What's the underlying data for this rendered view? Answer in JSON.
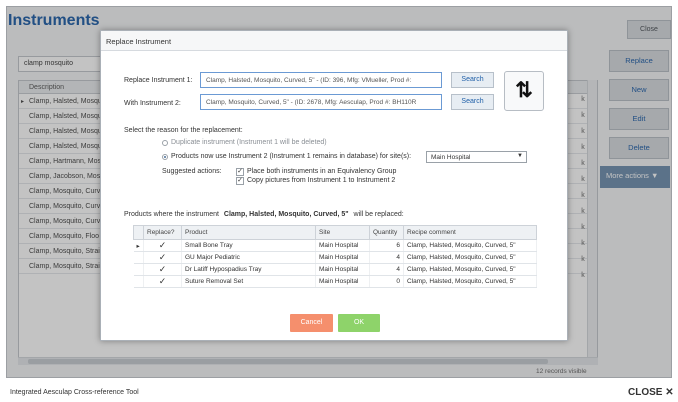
{
  "main": {
    "title": "Instruments",
    "close_label": "Close",
    "search_value": "clamp mosquito",
    "column_header": "Description",
    "rows": [
      "Clamp, Halsted, Mosqu",
      "Clamp, Halsted, Mosqu",
      "Clamp, Halsted, Mosqu",
      "Clamp, Halsted, Mosqu",
      "Clamp, Hartmann, Mos",
      "Clamp, Jacobson, Mosc",
      "Clamp, Mosquito, Curv",
      "Clamp, Mosquito, Curv",
      "Clamp, Mosquito, Curv",
      "Clamp, Mosquito, Floo",
      "Clamp, Mosquito, Strai",
      "Clamp, Mosquito, Strai"
    ],
    "right_column_char": "k",
    "records_text": "12 records visible",
    "side_buttons": [
      "Replace",
      "New",
      "Edit",
      "Delete"
    ],
    "more_actions": "More actions ▼",
    "footer_text": "Integrated Aesculap Cross-reference Tool",
    "footer_close": "CLOSE ✕"
  },
  "dialog": {
    "title": "Replace Instrument",
    "replace_label": "Replace Instrument 1:",
    "replace_value": "Clamp, Halsted, Mosquito, Curved, 5\" - (ID: 396, Mfg: VMueller, Prod #:",
    "with_label": "With Instrument 2:",
    "with_value": "Clamp, Mosquito, Curved, 5\" - (ID: 2678, Mfg: Aesculap, Prod #: BH110R",
    "search_label": "Search",
    "swap_icon_glyph": "⇅",
    "reason_label": "Select the reason for the replacement:",
    "option_duplicate": "Duplicate instrument (Instrument 1 will be deleted)",
    "option_products": "Products now use Instrument 2 (Instrument 1 remains in database) for site(s):",
    "site_select": "Main Hospital",
    "suggested_label": "Suggested actions:",
    "action_equivalency": "Place both instruments in an Equivalency Group",
    "action_copy": "Copy pictures from Instrument 1 to Instrument 2",
    "products_prefix": "Products where the instrument",
    "products_instrument": "Clamp, Halsted, Mosquito, Curved, 5\"",
    "products_suffix": "will be replaced:",
    "table_headers": [
      "Replace?",
      "Product",
      "Site",
      "Quantity",
      "Recipe comment"
    ],
    "table_rows": [
      {
        "product": "Small Bone Tray",
        "site": "Main Hospital",
        "quantity": "6",
        "comment": "Clamp, Halsted, Mosquito, Curved, 5\""
      },
      {
        "product": "GU Major Pediatric",
        "site": "Main Hospital",
        "quantity": "4",
        "comment": "Clamp, Halsted, Mosquito, Curved, 5\""
      },
      {
        "product": "Dr Latiff Hypospadius Tray",
        "site": "Main Hospital",
        "quantity": "4",
        "comment": "Clamp, Halsted, Mosquito, Curved, 5\""
      },
      {
        "product": "Suture Removal Set",
        "site": "Main Hospital",
        "quantity": "0",
        "comment": "Clamp, Halsted, Mosquito, Curved, 5\""
      }
    ],
    "checkmark": "✓",
    "cancel_label": "Cancel",
    "ok_label": "OK"
  }
}
